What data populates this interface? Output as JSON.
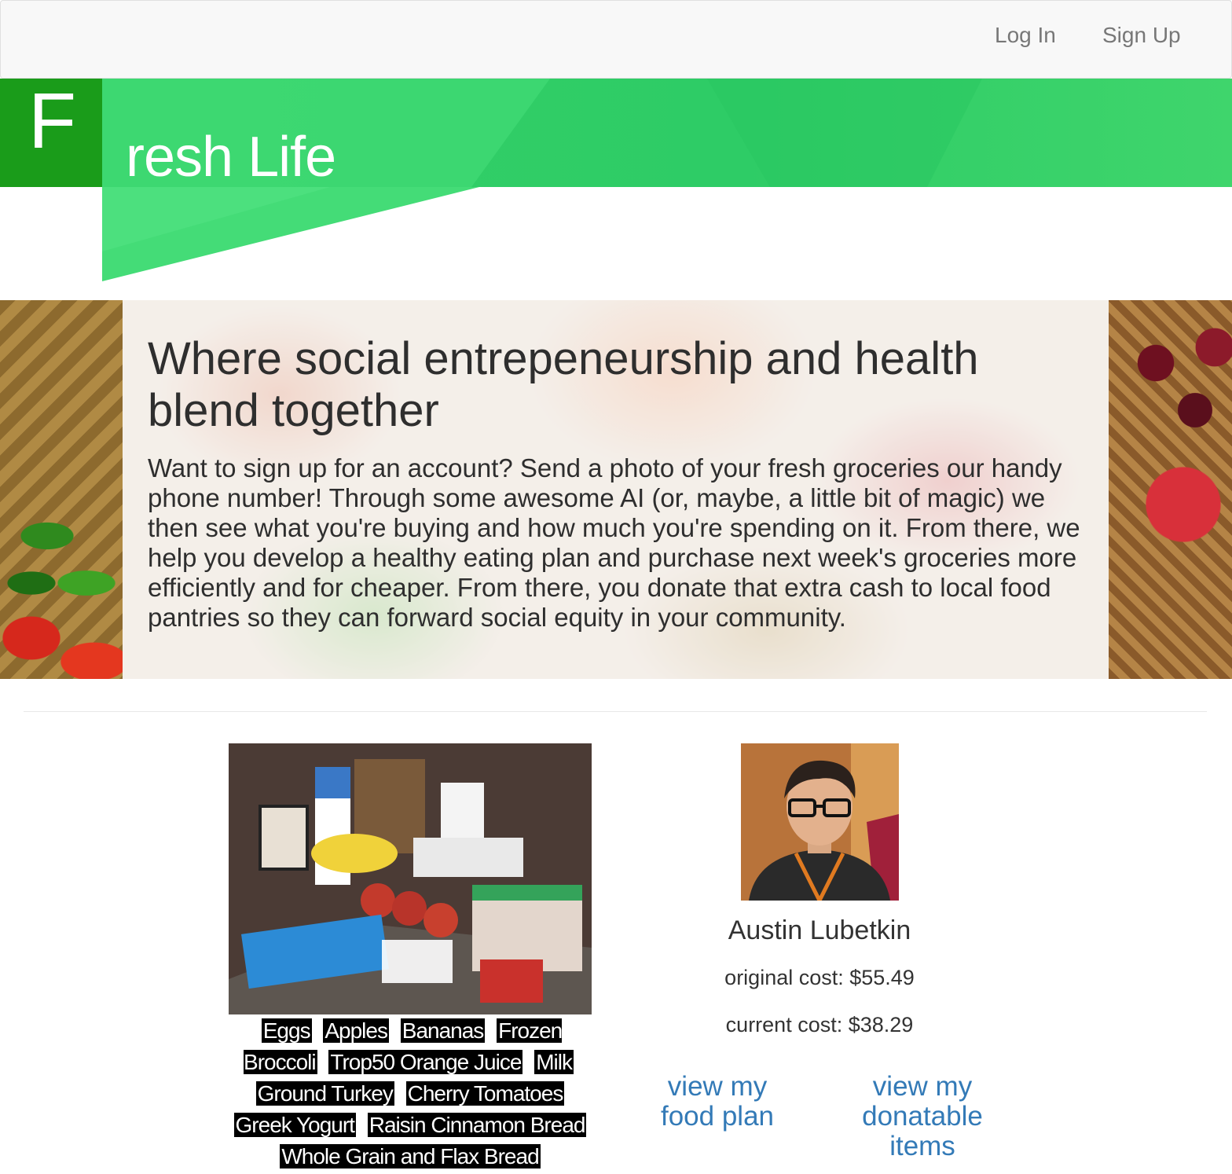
{
  "nav": {
    "login_label": "Log In",
    "signup_label": "Sign Up"
  },
  "brand": {
    "logo_letter": "F",
    "title": "resh Life",
    "colors": {
      "dark_green": "#1a9c1a",
      "light_green": "#3ad36a"
    }
  },
  "hero": {
    "heading": "Where social entrepeneurship and health blend together",
    "text": "Want to sign up for an account? Send a photo of your fresh groceries our handy phone number! Through some awesome AI (or, maybe, a little bit of magic) we then see what you're buying and how much you're spending on it. From there, we help you develop a healthy eating plan and purchase next week's groceries more efficiently and for cheaper. From there, you donate that extra cash to local food pantries so they can forward social equity in your community."
  },
  "groceries": {
    "items": [
      "Eggs",
      "Apples",
      "Bananas",
      "Frozen Broccoli",
      "Trop50 Orange Juice",
      "Milk",
      "Ground Turkey",
      "Cherry Tomatoes",
      "Greek Yogurt",
      "Raisin Cinnamon Bread",
      "Whole Grain and Flax Bread"
    ]
  },
  "profile": {
    "name": "Austin Lubetkin",
    "original_cost": "original cost: $55.49",
    "current_cost": "current cost: $38.29",
    "food_plan_link": "view my food plan",
    "donatable_link": "view my donatable items",
    "link_color": "#337ab7"
  }
}
